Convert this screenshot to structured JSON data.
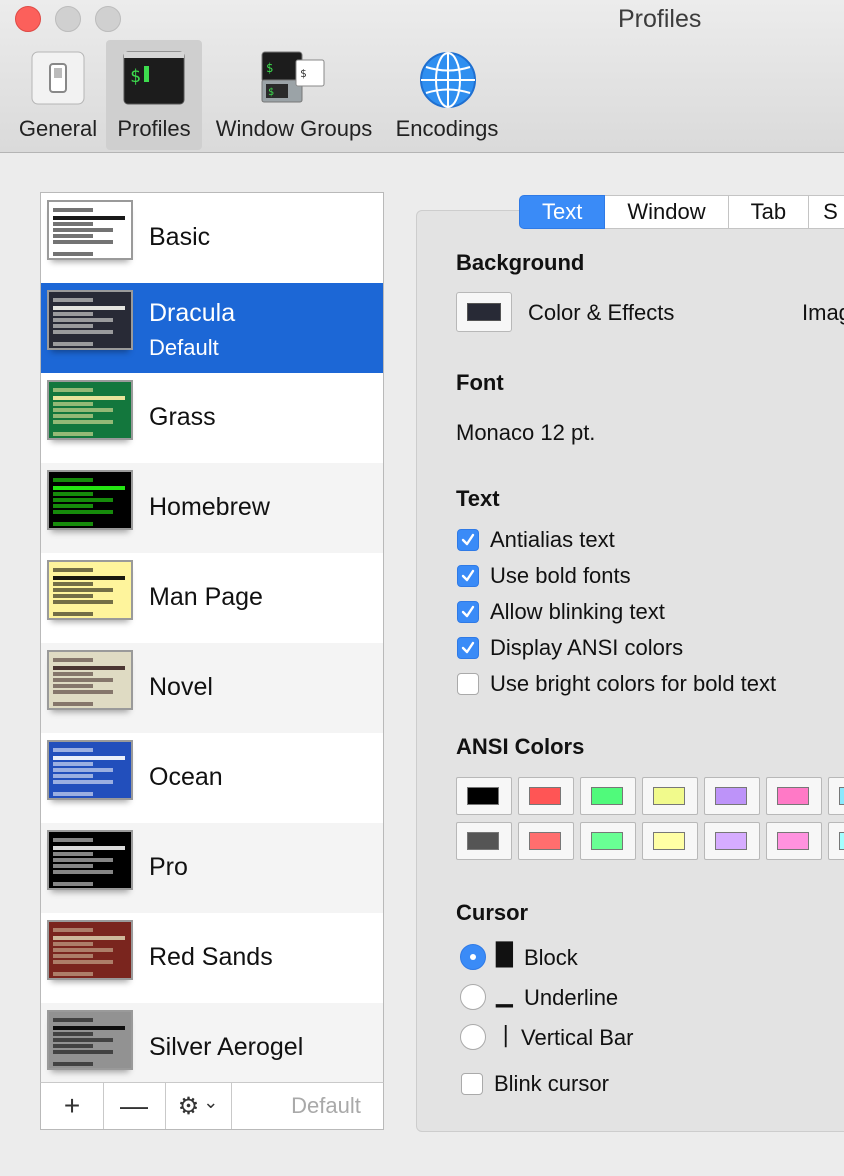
{
  "window": {
    "title": "Profiles"
  },
  "toolbar": {
    "items": [
      {
        "label": "General"
      },
      {
        "label": "Profiles"
      },
      {
        "label": "Window Groups"
      },
      {
        "label": "Encodings"
      }
    ]
  },
  "profiles": [
    {
      "name": "Basic",
      "bg": "#ffffff",
      "fg": "#000000"
    },
    {
      "name": "Dracula",
      "subtitle": "Default",
      "bg": "#282a36",
      "fg": "#f8f8f2"
    },
    {
      "name": "Grass",
      "bg": "#13773d",
      "fg": "#fff0a5"
    },
    {
      "name": "Homebrew",
      "bg": "#000000",
      "fg": "#28fe14"
    },
    {
      "name": "Man Page",
      "bg": "#fef49c",
      "fg": "#000000"
    },
    {
      "name": "Novel",
      "bg": "#dfdbc3",
      "fg": "#3b2322"
    },
    {
      "name": "Ocean",
      "bg": "#224fbc",
      "fg": "#ffffff"
    },
    {
      "name": "Pro",
      "bg": "#000000",
      "fg": "#f2f2f2"
    },
    {
      "name": "Red Sands",
      "bg": "#7a251e",
      "fg": "#d7c9a7"
    },
    {
      "name": "Silver Aerogel",
      "bg": "#929292",
      "fg": "#000000"
    }
  ],
  "list_bar": {
    "add": "+",
    "remove": "—",
    "gear": "⚙",
    "chevron": "⌄",
    "default_label": "Default"
  },
  "tabs": [
    {
      "label": "Text"
    },
    {
      "label": "Window"
    },
    {
      "label": "Tab"
    },
    {
      "label": "S"
    }
  ],
  "background": {
    "heading": "Background",
    "color_effects": "Color & Effects",
    "image": "Imag",
    "color": "#282a36"
  },
  "font": {
    "heading": "Font",
    "value": "Monaco 12 pt."
  },
  "text": {
    "heading": "Text",
    "options": [
      {
        "label": "Antialias text",
        "checked": true
      },
      {
        "label": "Use bold fonts",
        "checked": true
      },
      {
        "label": "Allow blinking text",
        "checked": true
      },
      {
        "label": "Display ANSI colors",
        "checked": true
      },
      {
        "label": "Use bright colors for bold text",
        "checked": false
      }
    ]
  },
  "ansi": {
    "heading": "ANSI Colors",
    "normal": [
      "#000000",
      "#ff5555",
      "#50fa7b",
      "#f1fa8c",
      "#bd93f9",
      "#ff79c6",
      "#8be9fd"
    ],
    "bright": [
      "#555555",
      "#ff6e6e",
      "#69ff94",
      "#ffffa5",
      "#d6acff",
      "#ff92df",
      "#a4ffff"
    ]
  },
  "cursor": {
    "heading": "Cursor",
    "options": [
      {
        "label": "Block",
        "glyph": "█",
        "selected": true
      },
      {
        "label": "Underline",
        "glyph": "▁",
        "selected": false
      },
      {
        "label": "Vertical Bar",
        "glyph": "|",
        "selected": false
      }
    ],
    "blink": {
      "label": "Blink cursor",
      "checked": false
    }
  }
}
